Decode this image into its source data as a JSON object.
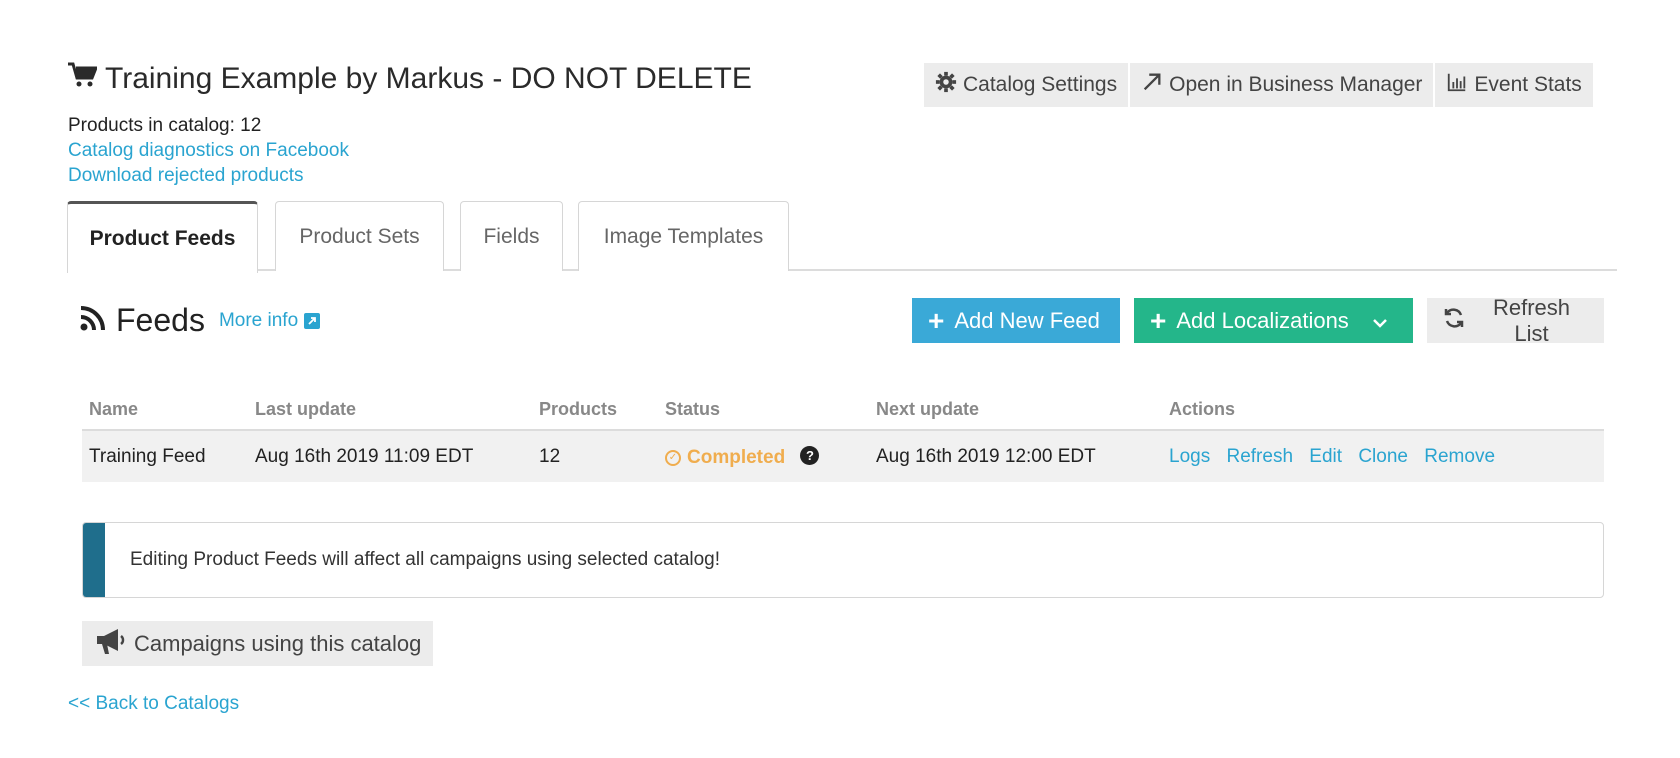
{
  "header": {
    "title": "Training Example by Markus - DO NOT DELETE",
    "buttons": {
      "catalog_settings": "Catalog Settings",
      "open_business_manager": "Open in Business Manager",
      "event_stats": "Event Stats"
    }
  },
  "meta": {
    "products_in_catalog": "Products in catalog: 12",
    "diagnostics_link": "Catalog diagnostics on Facebook",
    "download_rejected": "Download rejected products"
  },
  "tabs": [
    {
      "label": "Product Feeds",
      "active": true
    },
    {
      "label": "Product Sets",
      "active": false
    },
    {
      "label": "Fields",
      "active": false
    },
    {
      "label": "Image Templates",
      "active": false
    }
  ],
  "feeds": {
    "title": "Feeds",
    "more_info": "More info",
    "add_new_feed": "Add New Feed",
    "add_localizations": "Add Localizations",
    "refresh_list": "Refresh List"
  },
  "table": {
    "headers": [
      "Name",
      "Last update",
      "Products",
      "Status",
      "Next update",
      "Actions"
    ],
    "rows": [
      {
        "name": "Training Feed",
        "last_update": "Aug 16th 2019 11:09 EDT",
        "products": "12",
        "status": "Completed",
        "next_update": "Aug 16th 2019 12:00 EDT",
        "actions": [
          "Logs",
          "Refresh",
          "Edit",
          "Clone",
          "Remove"
        ]
      }
    ]
  },
  "notice": "Editing Product Feeds will affect all campaigns using selected catalog!",
  "campaigns_button": "Campaigns using this catalog",
  "back_link": "<< Back to Catalogs",
  "colors": {
    "accent_blue": "#3aa9d7",
    "accent_green": "#24b68a",
    "link": "#2aa4d0",
    "status_completed": "#f0ad4e",
    "notice_bar": "#1f6e8c"
  }
}
